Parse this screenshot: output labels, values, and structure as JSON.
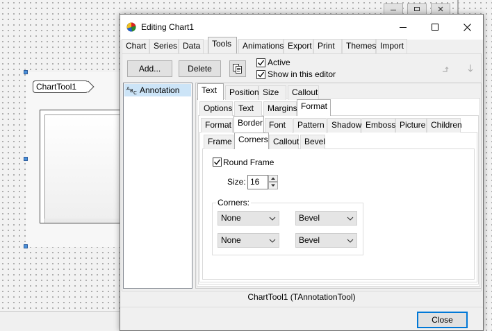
{
  "designer": {
    "chart_tool_label": "ChartTool1"
  },
  "dialog": {
    "title": "Editing Chart1",
    "main_tabs": [
      "Chart",
      "Series",
      "Data",
      "Tools",
      "Animations",
      "Export",
      "Print",
      "Themes",
      "Import"
    ],
    "selected_main_tab": "Tools",
    "toolbar": {
      "add_label": "Add...",
      "delete_label": "Delete",
      "active_label": "Active",
      "active_checked": true,
      "show_in_editor_label": "Show in this editor",
      "show_in_editor_checked": true
    },
    "tools_list": [
      "Annotation"
    ],
    "annotation_tabs": [
      "Text",
      "Position",
      "Size",
      "Callout"
    ],
    "text_tabs": [
      "Options",
      "Text",
      "Margins",
      "Format"
    ],
    "format_tabs": [
      "Format",
      "Border",
      "Font",
      "Pattern",
      "Shadow",
      "Emboss",
      "Picture",
      "Children"
    ],
    "border_tabs": [
      "Frame",
      "Corners",
      "Callout",
      "Bevel"
    ],
    "corners_page": {
      "round_frame_label": "Round Frame",
      "round_frame_checked": true,
      "size_label": "Size:",
      "size_value": "16",
      "corners_group_label": "Corners:",
      "corner_1_value": "None",
      "corner_2_value": "Bevel",
      "corner_3_value": "None",
      "corner_4_value": "Bevel"
    },
    "status_text": "ChartTool1 (TAnnotationTool)",
    "close_label": "Close"
  },
  "colors": {
    "accent": "#0078d7",
    "selection": "#cce4f7"
  }
}
